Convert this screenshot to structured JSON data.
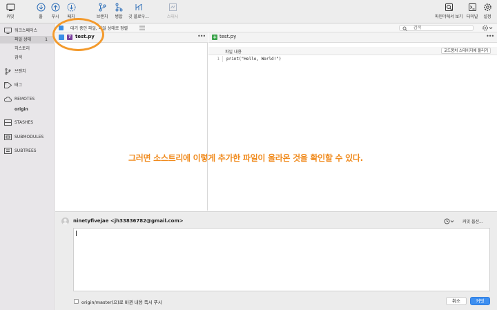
{
  "toolbar": {
    "left": [
      {
        "label": "커밋",
        "icon": "commit-icon"
      },
      {
        "label": "풀",
        "icon": "pull-icon"
      },
      {
        "label": "푸시",
        "icon": "push-icon"
      },
      {
        "label": "페치",
        "icon": "fetch-icon"
      },
      {
        "label": "브랜치",
        "icon": "branch-icon"
      },
      {
        "label": "병합",
        "icon": "merge-icon"
      },
      {
        "label": "깃 플로우...",
        "icon": "git-flow-icon"
      },
      {
        "label": "스태시",
        "icon": "stash-icon"
      }
    ],
    "right": [
      {
        "label": "파인더에서 보기",
        "icon": "finder-icon"
      },
      {
        "label": "터미널",
        "icon": "terminal-icon"
      },
      {
        "label": "설정",
        "icon": "settings-icon"
      }
    ]
  },
  "sidebar": {
    "workspace": "워크스페이스",
    "file_status": "파일 상태",
    "file_status_count": "1",
    "history": "히스토리",
    "search": "검색",
    "branches": "브랜치",
    "tags": "태그",
    "remotes": "REMOTES",
    "origin": "origin",
    "stashes": "STASHES",
    "submodules": "SUBMODULES",
    "subtrees": "SUBTREES"
  },
  "filterbar": {
    "label": "대기 중인 파일, 파일 상태로 정렬",
    "search_placeholder": "검색"
  },
  "files": {
    "name": "test.py",
    "status_glyph": "?"
  },
  "diff": {
    "file_name": "test.py",
    "hunk_title": "파일 내용",
    "stage_hunk_button": "코드뭉치 스테이지에 올리기",
    "lines": [
      {
        "number": "1",
        "code": "print(\"Hello, World!\")"
      }
    ]
  },
  "annotation": {
    "text": "그러면 소스트리에 이렇게 추가한 파일이 올라온 것을 확인할 수 있다.",
    "color": "#f08a1c"
  },
  "commit": {
    "author": "ninetyfivejae <jh33836782@gmail.com>",
    "options_label": "커밋 옵션...",
    "message": "",
    "push_label": "origin/master(으)로 바뀐 내용 즉시 푸시",
    "push_checked": false,
    "cancel_label": "취소",
    "commit_label": "커밋"
  },
  "colors": {
    "accent": "#3e8ff0",
    "annotation": "#f08a1c"
  }
}
